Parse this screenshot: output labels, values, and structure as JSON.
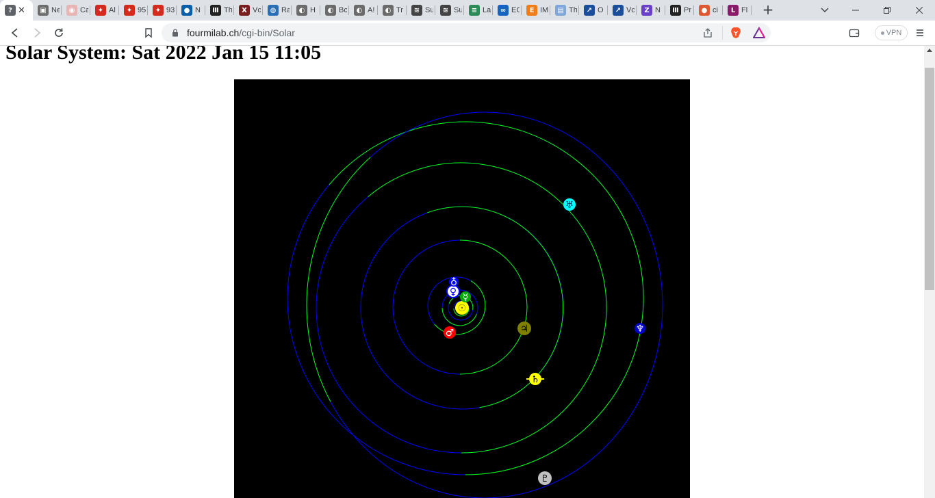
{
  "browser": {
    "tabs": [
      {
        "icon": "fourmilab-favicon-icon",
        "title": "",
        "color": "#5f6368",
        "glyph": "?",
        "active": true
      },
      {
        "icon": "image-favicon-icon",
        "title": "Ne",
        "color": "#6d6d6d",
        "glyph": "▣"
      },
      {
        "icon": "shield-favicon-icon",
        "title": "Ca",
        "color": "#e8b4b4",
        "glyph": "◉"
      },
      {
        "icon": "maple-leaf-favicon-icon",
        "title": "Al",
        "color": "#d52b1e",
        "glyph": "✦"
      },
      {
        "icon": "maple-leaf-favicon-icon",
        "title": "95",
        "color": "#d52b1e",
        "glyph": "✦"
      },
      {
        "icon": "maple-leaf-favicon-icon",
        "title": "93",
        "color": "#d52b1e",
        "glyph": "✦"
      },
      {
        "icon": "noaa-favicon-icon",
        "title": "N",
        "color": "#0a5fa8",
        "glyph": "●"
      },
      {
        "icon": "museum-favicon-icon",
        "title": "Th",
        "color": "#222222",
        "glyph": "Ⅲ"
      },
      {
        "icon": "x-favicon-icon",
        "title": "Vc",
        "color": "#7a1f1f",
        "glyph": "X"
      },
      {
        "icon": "globe-favicon-icon",
        "title": "Ra",
        "color": "#2a6fb5",
        "glyph": "◍"
      },
      {
        "icon": "globe-favicon-icon",
        "title": "H",
        "color": "#6b6b6b",
        "glyph": "◐"
      },
      {
        "icon": "globe-favicon-icon",
        "title": "Bc",
        "color": "#6b6b6b",
        "glyph": "◐"
      },
      {
        "icon": "globe-favicon-icon",
        "title": "A!",
        "color": "#6b6b6b",
        "glyph": "◐"
      },
      {
        "icon": "globe-favicon-icon",
        "title": "Tr",
        "color": "#6b6b6b",
        "glyph": "◐"
      },
      {
        "icon": "stripes-favicon-icon",
        "title": "Su",
        "color": "#444444",
        "glyph": "≋"
      },
      {
        "icon": "stripes-favicon-icon",
        "title": "Su",
        "color": "#444444",
        "glyph": "≋"
      },
      {
        "icon": "layers-favicon-icon",
        "title": "La",
        "color": "#2e8b57",
        "glyph": "≡"
      },
      {
        "icon": "ec-favicon-icon",
        "title": "EC",
        "color": "#1565c0",
        "glyph": "∞"
      },
      {
        "icon": "e-favicon-icon",
        "title": "IM",
        "color": "#ef7d1a",
        "glyph": "E"
      },
      {
        "icon": "doc-favicon-icon",
        "title": "Th",
        "color": "#7fa7d8",
        "glyph": "▤"
      },
      {
        "icon": "rocket-favicon-icon",
        "title": "O",
        "color": "#1b4f9c",
        "glyph": "↗"
      },
      {
        "icon": "rocket-favicon-icon",
        "title": "Vc",
        "color": "#1b4f9c",
        "glyph": "↗"
      },
      {
        "icon": "nz-favicon-icon",
        "title": "N",
        "color": "#6a40c8",
        "glyph": "Z"
      },
      {
        "icon": "museum-favicon-icon",
        "title": "Pr",
        "color": "#222222",
        "glyph": "Ⅲ"
      },
      {
        "icon": "duckduckgo-favicon-icon",
        "title": "ci",
        "color": "#de5833",
        "glyph": "●"
      },
      {
        "icon": "l-favicon-icon",
        "title": "Fl",
        "color": "#8b1a6b",
        "glyph": "L"
      }
    ],
    "url_host": "fourmilab.ch",
    "url_path": "/cgi-bin/Solar",
    "vpn_label": "VPN"
  },
  "page": {
    "title": "Solar System: Sat 2022 Jan 15 11:05"
  },
  "orrery": {
    "colors": {
      "background": "#000000",
      "orbit_near": "#00ff00",
      "orbit_far": "#0000ff",
      "sun": "#ffff00",
      "mercury": "#00aa00",
      "venus": "#ffffff",
      "earth": "#0000ff",
      "mars": "#ff0000",
      "jupiter": "#808000",
      "saturn": "#ffff00",
      "uranus": "#00ffff",
      "neptune": "#0000cc",
      "pluto": "#c0c0c0"
    },
    "planets": [
      {
        "name": "sun",
        "symbol": "☉"
      },
      {
        "name": "mercury",
        "symbol": "☿"
      },
      {
        "name": "venus",
        "symbol": "♀"
      },
      {
        "name": "earth",
        "symbol": "♁"
      },
      {
        "name": "mars",
        "symbol": "♂"
      },
      {
        "name": "jupiter",
        "symbol": "♃"
      },
      {
        "name": "saturn",
        "symbol": "♄"
      },
      {
        "name": "uranus",
        "symbol": "♅"
      },
      {
        "name": "neptune",
        "symbol": "♆"
      },
      {
        "name": "pluto",
        "symbol": "♇"
      }
    ]
  }
}
